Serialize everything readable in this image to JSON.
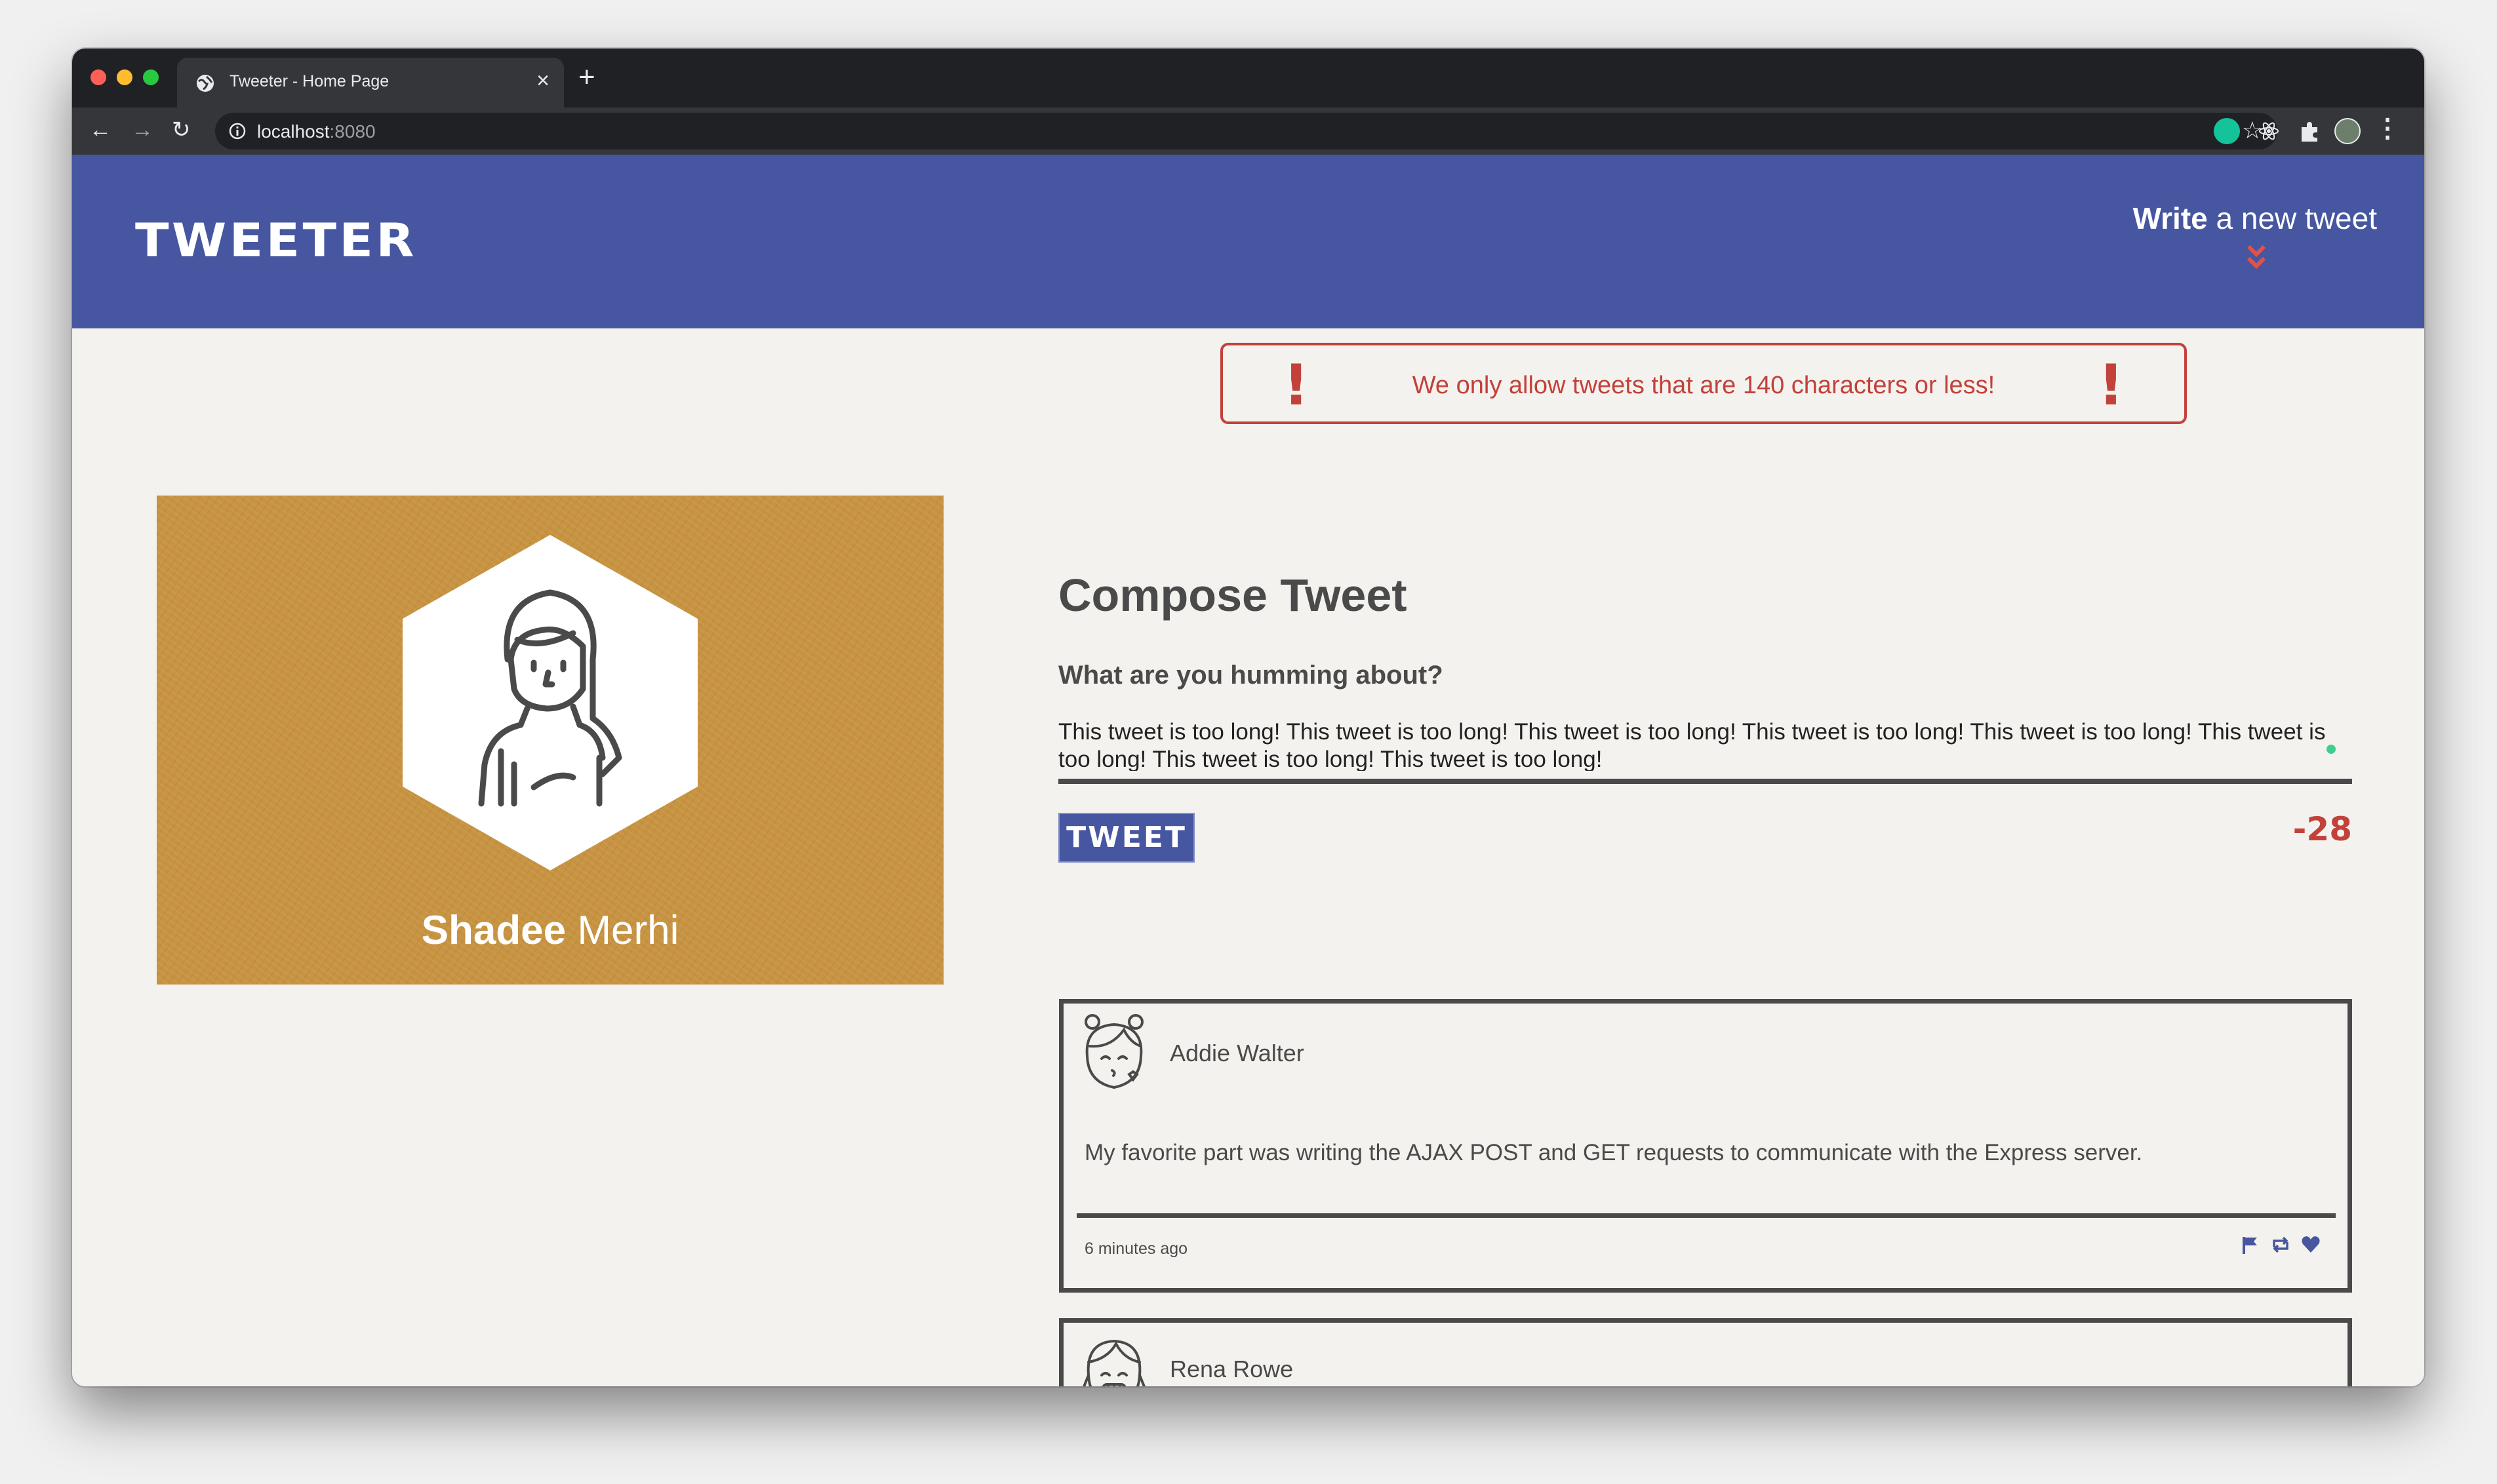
{
  "browser": {
    "tab_title": "Tweeter - Home Page",
    "url_host": "localhost",
    "url_port": ":8080"
  },
  "header": {
    "logo": "TWEETER",
    "write_bold": "Write",
    "write_rest": " a new tweet"
  },
  "error": {
    "message": "We only allow tweets that are 140 characters or less!"
  },
  "profile": {
    "first_name": "Shadee",
    "last_name": " Merhi"
  },
  "compose": {
    "title": "Compose Tweet",
    "label": "What are you humming about?",
    "text": "This tweet is too long! This tweet is too long! This tweet is too long! This tweet is too long! This tweet is too long! This tweet is too long! This tweet is too long! This tweet is too long!",
    "button": "TWEET",
    "counter": "-28"
  },
  "tweets": [
    {
      "name": "Addie Walter",
      "content": "My favorite part was writing the AJAX POST and GET requests to communicate with the Express server.",
      "time": "6 minutes ago"
    },
    {
      "name": "Rena Rowe"
    }
  ],
  "colors": {
    "brand": "#4656a0",
    "error": "#c2413a",
    "profile_bg": "#c79341"
  }
}
